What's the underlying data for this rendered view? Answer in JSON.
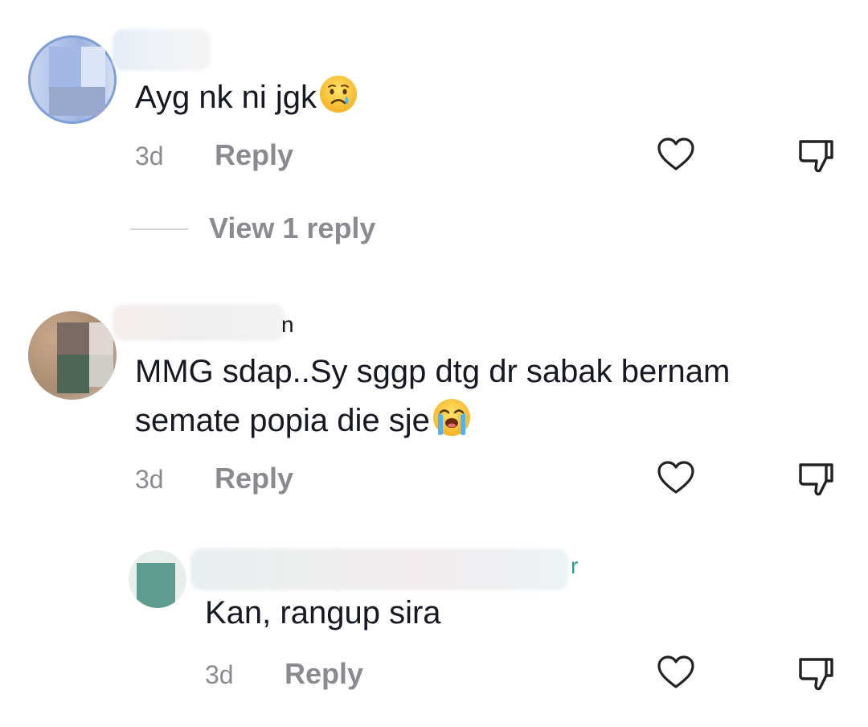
{
  "comments": [
    {
      "text": "Ayg nk ni jgk",
      "emoji": "crying-face-emoji",
      "time": "3d",
      "reply_label": "Reply",
      "view_replies": "View 1 reply"
    },
    {
      "name_tail": "n",
      "text_line1": "MMG sdap..Sy sggp dtg dr sabak bernam",
      "text_line2": "semate popia die sje",
      "emoji": "loudly-crying-face-emoji",
      "time": "3d",
      "reply_label": "Reply",
      "replies": [
        {
          "name_tail": "r",
          "text": "Kan, rangup sira",
          "time": "3d",
          "reply_label": "Reply"
        }
      ]
    }
  ],
  "colors": {
    "text": "#161823",
    "meta": "#8a8b91",
    "reply_name_accent": "#2a9d8f"
  },
  "icons": [
    "heart-outline-icon",
    "thumbs-down-outline-icon"
  ]
}
